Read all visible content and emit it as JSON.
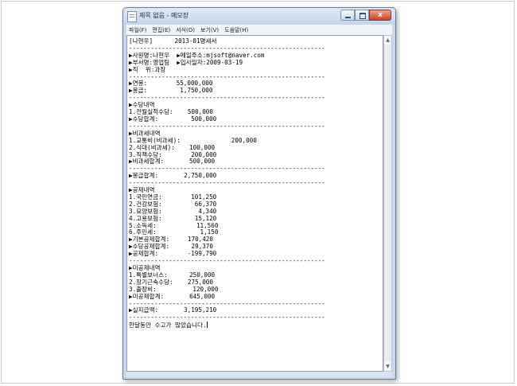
{
  "window": {
    "title": "제목 없음 - 메모장",
    "controls": {
      "minimize": "–",
      "maximize": "□",
      "close": "x"
    }
  },
  "menubar": {
    "items": [
      "파일(F)",
      "편집(E)",
      "서식(O)",
      "보기(V)",
      "도움말(H)"
    ]
  },
  "document": {
    "lines": [
      "[나현우]      2013-01명세서",
      "------------------------------------------------------",
      "▶사원명:나현우  ▶메일주소:mjsoft@naver.com",
      "▶부서명:영업팀  ▶입사일자:2009-03-19",
      "▶직  위:과장",
      "------------------------------------------------------",
      "▶연봉:        55,000,000",
      "▶봉급:         1,750,000",
      "------------------------------------------------------",
      "▶수당내역",
      "1.전월실적수당:    500,000",
      "▶수당합계:         500,000",
      "------------------------------------------------------",
      "▶비과세내역",
      "1.교통비(비과세):              200,000",
      "2.식대(비과세):    100,000",
      "3.직책수당:        200,000",
      "▶비과세합계:       500,000",
      "------------------------------------------------------",
      "▶봉급합계:       2,750,000",
      "------------------------------------------------------",
      "▶공제내역",
      "1.국민연금:        101,250",
      "2.건강보험:         66,370",
      "3.요양보험:          4,340",
      "4.고용보험:         15,120",
      "5.소득세:           11,560",
      "6.주민세:            1,150",
      "▶기본공제합계:     170,420",
      "▶수당공제합계:      29,370",
      "▶공제합계:        -199,790",
      "------------------------------------------------------",
      "▶미공제내역",
      "1.특별보너스:      250,000",
      "2.장기근속수당:    275,000",
      "3.출장비:          120,000",
      "▶미공제합계:       645,000",
      "------------------------------------------------------",
      "▶실지급액:       3,195,210",
      "------------------------------------------------------",
      "한달동안 수고가 많았습니다."
    ]
  },
  "scrollbar": {
    "up": "▲",
    "down": "▼"
  }
}
